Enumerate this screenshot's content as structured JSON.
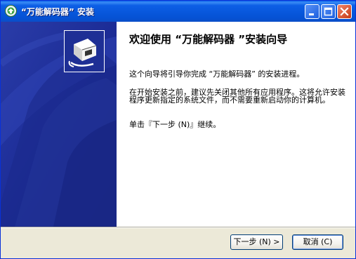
{
  "window": {
    "title": "“万能解码器” 安装"
  },
  "content": {
    "heading": "欢迎使用 “万能解码器 ”安装向导",
    "paragraph1": "这个向导将引导你完成 “万能解码器” 的安装进程。",
    "paragraph2": "在开始安装之前，建议先关闭其他所有应用程序。这将允许安装程序更新指定的系统文件，而不需要重新启动你的计算机。",
    "paragraph3": "单击『下一步 (N)』继续。"
  },
  "buttons": {
    "next_label": "下一步 (N) >",
    "cancel_label": "取消 (C)"
  },
  "colors": {
    "titlebar": "#0756db",
    "sidepanel": "#1a2b95",
    "dialog_bg": "#ece9d8",
    "close_button": "#c63a15"
  },
  "icons": {
    "app": "disc-setup-icon",
    "wizard": "installer-box-icon"
  }
}
